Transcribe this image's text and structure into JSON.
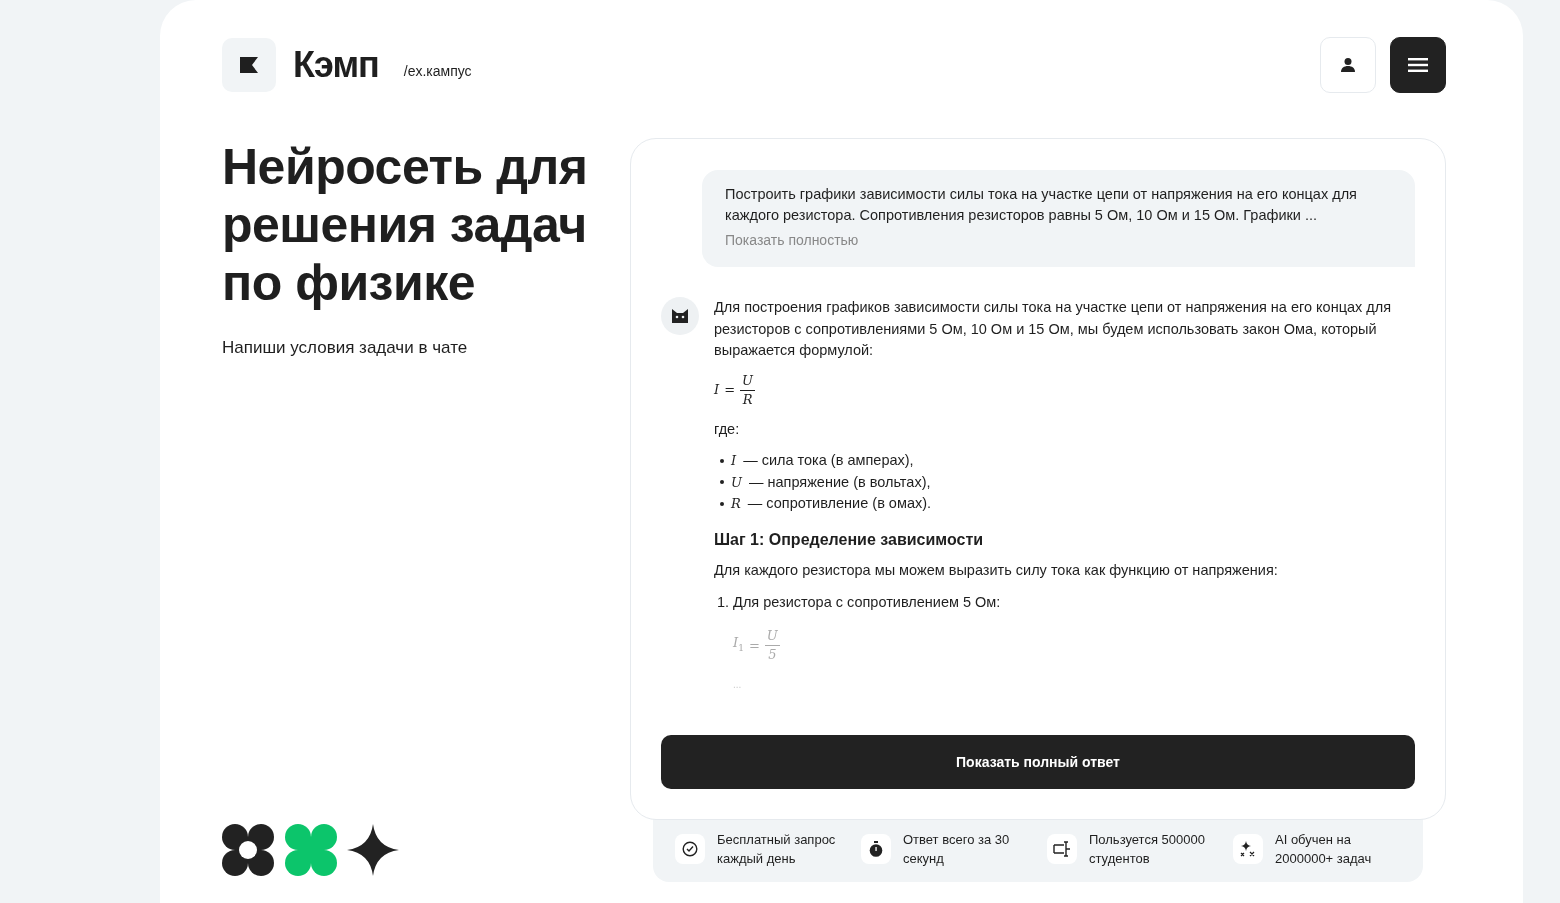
{
  "header": {
    "logo_text": "Кэмп",
    "logo_sub": "/ex.кампус"
  },
  "hero": {
    "title": "Нейросеть для решения задач по физике",
    "subtitle": "Напиши условия задачи в чате"
  },
  "chat": {
    "user_message": {
      "text": "Построить графики зависимости силы тока на участке цепи от напряжения на его концах для каждого резистора. Сопротивления резисторов равны 5 Ом, 10 Ом и 15 Ом. Графики ...",
      "expand_link": "Показать полностью"
    },
    "answer": [
      {
        "kind": "paragraph",
        "text": "Для построения графиков зависимости силы тока на участке цепи от напряжения на его концах для резисторов с сопротивлениями 5 Ом, 10 Ом и 15 Ом, мы будем использовать закон Ома, который выражается формулой:"
      },
      {
        "kind": "formula",
        "lhs": "I",
        "eq": "=",
        "num": "U",
        "den": "R"
      },
      {
        "kind": "paragraph",
        "text": "где:"
      },
      {
        "kind": "bullets",
        "items": [
          {
            "symbol": "I",
            "text": "— сила тока (в амперах),"
          },
          {
            "symbol": "U",
            "text": "— напряжение (в вольтах),"
          },
          {
            "symbol": "R",
            "text": "— сопротивление (в омах)."
          }
        ]
      },
      {
        "kind": "heading",
        "text": "Шаг 1: Определение зависимости"
      },
      {
        "kind": "paragraph",
        "text": "Для каждого резистора мы можем выразить силу тока как функцию от напряжения:"
      },
      {
        "kind": "numbered",
        "number": "1.",
        "text": "Для резистора с сопротивлением 5 Ом:"
      },
      {
        "kind": "formula",
        "lhs": "I",
        "sub": "1",
        "eq": "=",
        "num": "U",
        "den": "5",
        "faded": true
      },
      {
        "kind": "ellipsis",
        "text": "..."
      }
    ],
    "button": "Показать полный ответ"
  },
  "features": [
    {
      "kind": "free",
      "text": "Бесплатный запрос каждый день"
    },
    {
      "kind": "speed",
      "text": "Ответ всего за 30 секунд"
    },
    {
      "kind": "users",
      "text": "Пользуется 500000 студентов"
    },
    {
      "kind": "training",
      "text": "AI обучен на 2000000+ задач"
    }
  ]
}
